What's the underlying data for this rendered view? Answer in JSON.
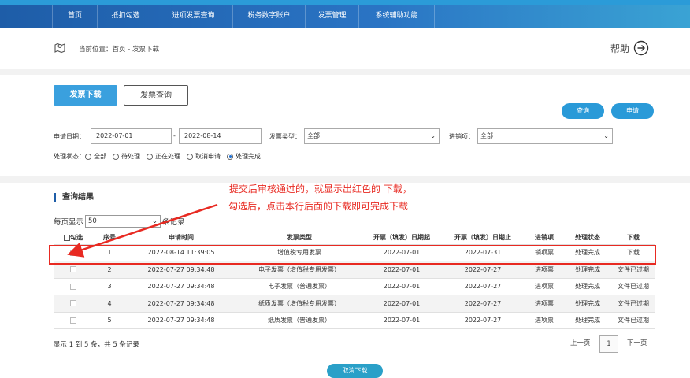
{
  "nav": {
    "items": [
      "首页",
      "抵扣勾选",
      "进项发票查询",
      "税务数字账户",
      "发票管理",
      "系统辅助功能"
    ]
  },
  "breadcrumb": {
    "text": "当前位置：首页 - 发票下载"
  },
  "help": {
    "label": "帮助"
  },
  "tabs": {
    "download": "发票下载",
    "query": "发票查询"
  },
  "actions": {
    "query": "查询",
    "apply": "申请"
  },
  "filters": {
    "date_label": "申请日期：",
    "date_start": "2022-07-01",
    "date_sep": "-",
    "date_end": "2022-08-14",
    "type_label": "发票类型：",
    "type_value": "全部",
    "direction_label": "进销项：",
    "direction_value": "全部",
    "status_label": "处理状态：",
    "status_options": [
      "全部",
      "待处理",
      "正在处理",
      "取消申请",
      "处理完成"
    ],
    "status_selected": "处理完成"
  },
  "results": {
    "title": "查询结果",
    "per_page_label": "每页显示",
    "per_page_value": "50",
    "per_page_suffix": "条记录",
    "columns": [
      "勾选",
      "序号",
      "申请时间",
      "发票类型",
      "开票（填发）日期起",
      "开票（填发）日期止",
      "进销项",
      "处理状态",
      "下载"
    ],
    "rows": [
      {
        "no": "1",
        "time": "2022-08-14 11:39:05",
        "type": "增值税专用发票",
        "start": "2022-07-01",
        "end": "2022-07-31",
        "dir": "销项票",
        "status": "处理完成",
        "download": "下载"
      },
      {
        "no": "2",
        "time": "2022-07-27 09:34:48",
        "type": "电子发票（增值税专用发票）",
        "start": "2022-07-01",
        "end": "2022-07-27",
        "dir": "进项票",
        "status": "处理完成",
        "download": "文件已过期"
      },
      {
        "no": "3",
        "time": "2022-07-27 09:34:48",
        "type": "电子发票（普通发票）",
        "start": "2022-07-01",
        "end": "2022-07-27",
        "dir": "进项票",
        "status": "处理完成",
        "download": "文件已过期"
      },
      {
        "no": "4",
        "time": "2022-07-27 09:34:48",
        "type": "纸质发票（增值税专用发票）",
        "start": "2022-07-01",
        "end": "2022-07-27",
        "dir": "进项票",
        "status": "处理完成",
        "download": "文件已过期"
      },
      {
        "no": "5",
        "time": "2022-07-27 09:34:48",
        "type": "纸质发票（普通发票）",
        "start": "2022-07-01",
        "end": "2022-07-27",
        "dir": "进项票",
        "status": "处理完成",
        "download": "文件已过期"
      }
    ],
    "summary": "显示 1 到 5 条，共 5 条记录",
    "prev": "上一页",
    "page": "1",
    "next": "下一页"
  },
  "cancel_download": "取消下载",
  "annotation": {
    "line1": "提交后审核通过的，就显示出红色的  下载，",
    "line2": "勾选后，点击本行后面的下载即可完成下载",
    "color": "#e82a22"
  }
}
